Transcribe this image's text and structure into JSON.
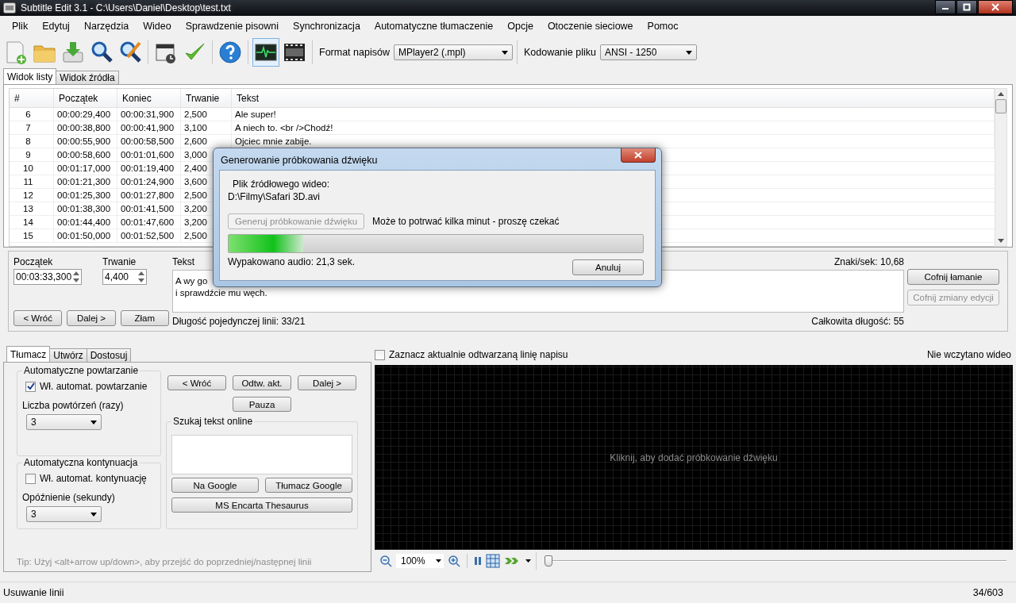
{
  "window": {
    "title": "Subtitle Edit 3.1 - C:\\Users\\Daniel\\Desktop\\test.txt"
  },
  "menu": [
    "Plik",
    "Edytuj",
    "Narzędzia",
    "Wideo",
    "Sprawdzenie pisowni",
    "Synchronizacja",
    "Automatyczne tłumaczenie",
    "Opcje",
    "Otoczenie sieciowe",
    "Pomoc"
  ],
  "toolbar": {
    "buttons": [
      {
        "kind": "new",
        "selected": false
      },
      {
        "kind": "open",
        "selected": false
      },
      {
        "kind": "download",
        "selected": false
      },
      {
        "kind": "find",
        "selected": false
      },
      {
        "kind": "replace",
        "selected": false
      },
      {
        "kind": "clapper",
        "selected": false
      },
      {
        "kind": "check",
        "selected": false
      },
      {
        "kind": "help",
        "selected": false
      },
      {
        "kind": "wave",
        "selected": true
      },
      {
        "kind": "film",
        "selected": false
      }
    ],
    "format_label": "Format napisów",
    "format_value": "MPlayer2 (.mpl)",
    "encoding_label": "Kodowanie pliku",
    "encoding_value": "ANSI - 1250"
  },
  "view_tabs": [
    {
      "label": "Widok listy",
      "selected": true
    },
    {
      "label": "Widok źródła",
      "selected": false
    }
  ],
  "table": {
    "columns": [
      "#",
      "Początek",
      "Koniec",
      "Trwanie",
      "Tekst"
    ],
    "rows": [
      {
        "cells": [
          "6",
          "00:00:29,400",
          "00:00:31,900",
          "2,500",
          "Ale super!"
        ]
      },
      {
        "cells": [
          "7",
          "00:00:38,800",
          "00:00:41,900",
          "3,100",
          "A niech to. <br />Chodź!"
        ]
      },
      {
        "cells": [
          "8",
          "00:00:55,900",
          "00:00:58,500",
          "2,600",
          "Ojciec mnie zabije."
        ]
      },
      {
        "cells": [
          "9",
          "00:00:58,600",
          "00:01:01,600",
          "3,000"
        ]
      },
      {
        "cells": [
          "10",
          "00:01:17,000",
          "00:01:19,400",
          "2,400"
        ]
      },
      {
        "cells": [
          "11",
          "00:01:21,300",
          "00:01:24,900",
          "3,600"
        ]
      },
      {
        "cells": [
          "12",
          "00:01:25,300",
          "00:01:27,800",
          "2,500"
        ]
      },
      {
        "cells": [
          "13",
          "00:01:38,300",
          "00:01:41,500",
          "3,200"
        ]
      },
      {
        "cells": [
          "14",
          "00:01:44,400",
          "00:01:47,600",
          "3,200"
        ]
      },
      {
        "cells": [
          "15",
          "00:01:50,000",
          "00:01:52,500",
          "2,500"
        ]
      }
    ]
  },
  "editor": {
    "start_label": "Początek",
    "start_value": "00:03:33,300",
    "duration_label": "Trwanie",
    "duration_value": "4,400",
    "text_label": "Tekst",
    "text_lines": [
      "A wy go",
      "i sprawdźcie mu węch."
    ],
    "chars_per_sec": "Znaki/sek: 10,68",
    "line_length": "Długość pojedynczej linii: 33/21",
    "total_length": "Całkowita długość: 55",
    "nav_buttons": [
      "< Wróć",
      "Dalej >",
      "Złam"
    ],
    "side_buttons": [
      {
        "label": "Cofnij łamanie",
        "disabled": false
      },
      {
        "label": "Cofnij zmiany edycji",
        "disabled": true
      }
    ]
  },
  "translator": {
    "tabs": [
      {
        "label": "Tłumacz",
        "selected": true
      },
      {
        "label": "Utwórz",
        "selected": false
      },
      {
        "label": "Dostosuj",
        "selected": false
      }
    ],
    "repeat_group": {
      "title": "Automatyczne powtarzanie",
      "checkbox": {
        "label": "Wł. automat. powtarzanie",
        "checked": true
      },
      "count_label": "Liczba powtórzeń (razy)",
      "count_value": "3"
    },
    "continue_group": {
      "title": "Automatyczna kontynuacja",
      "checkbox": {
        "label": "Wł. automat. kontynuację",
        "checked": false
      },
      "count_label": "Opóźnienie (sekundy)",
      "count_value": "3"
    },
    "play_buttons": [
      "< Wróć",
      "Odtw. akt.",
      "Dalej >",
      "Pauza"
    ],
    "search_group": {
      "title": "Szukaj tekst online",
      "buttons": [
        "Na Google",
        "Tłumacz Google",
        "MS Encarta Thesaurus"
      ]
    },
    "tip": "Tip: Użyj <alt+arrow up/down>, aby przejść do poprzedniej/następnej linii"
  },
  "waveform": {
    "checkbox": {
      "label": "Zaznacz aktualnie odtwarzaną linię napisu",
      "checked": false
    },
    "video_status": "Nie wczytano wideo",
    "message": "Kliknij, aby dodać próbkowanie dźwięku",
    "zoom": "100%",
    "position": {
      "level": 0
    }
  },
  "dialog": {
    "title": "Generowanie próbkowania dźwięku",
    "source_label": "Plik źródłowego wideo:",
    "source_path": "D:\\Filmy\\Safari 3D.avi",
    "generate_button": {
      "label": "Generuj próbkowanie dźwięku",
      "disabled": true
    },
    "note": "Może to potrwać kilka minut - proszę czekać",
    "progress": {
      "level": 0.18
    },
    "status": "Wypakowano audio: 21,3 sek.",
    "cancel_button": "Anuluj"
  },
  "status_bar": {
    "message": "Usuwanie linii",
    "position": "34/603"
  }
}
